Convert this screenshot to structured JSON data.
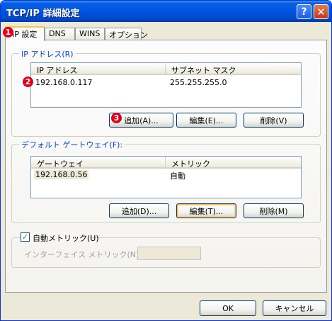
{
  "window": {
    "title": "TCP/IP 詳細設定",
    "help": "?",
    "close": "✕"
  },
  "tabs": [
    "IP 設定",
    "DNS",
    "WINS",
    "オプション"
  ],
  "markers": [
    "1",
    "2",
    "3"
  ],
  "ip_group": {
    "legend": "IP アドレス(R)",
    "columns": [
      "IP アドレス",
      "サブネット マスク"
    ],
    "rows": [
      {
        "ip": "192.168.0.117",
        "mask": "255.255.255.0"
      }
    ],
    "buttons": {
      "add": "追加(A)...",
      "edit": "編集(E)...",
      "delete": "削除(V)"
    }
  },
  "gateway_group": {
    "legend": "デフォルト ゲートウェイ(F):",
    "columns": [
      "ゲートウェイ",
      "メトリック"
    ],
    "rows": [
      {
        "gateway": "192.168.0.56",
        "metric": "自動"
      }
    ],
    "buttons": {
      "add": "追加(D)...",
      "edit": "編集(T)...",
      "delete": "削除(M)"
    }
  },
  "metric": {
    "checkbox_label": "自動メトリック(U)",
    "checked": true,
    "interface_label": "インターフェイス メトリック(N):",
    "interface_value": ""
  },
  "footer": {
    "ok": "OK",
    "cancel": "キャンセル"
  },
  "colors": {
    "titlebar": "#0054e3",
    "legend": "#0046d5",
    "marker": "#e3001b",
    "tab_highlight": "#ffc83c"
  }
}
